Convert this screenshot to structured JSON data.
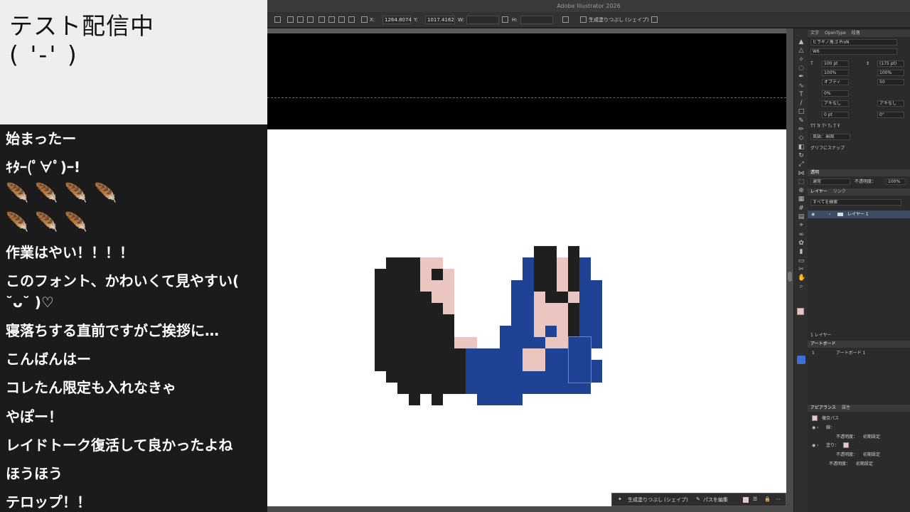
{
  "stream_title": {
    "line1": "テスト配信中",
    "line2": "( '-' )"
  },
  "chat": {
    "messages": [
      "始まったー",
      "ｷﾀｰ(ﾟ∀ﾟ)ｰ!",
      "作業はやい！！！！",
      "このフォント、かわいくて見やすい( ˘ᴗ˘ )♡",
      "寝落ちする直前ですがご挨拶に…",
      "こんばんはー",
      "コレたん限定も入れなきゃ",
      "やぽー！",
      "レイドトーク復活して良かったよね",
      "ほうほう",
      "テロップ！！"
    ],
    "emote_row1": "🪶🪶🪶🪶",
    "emote_row2": "🪶🪶🪶"
  },
  "app": {
    "title": "Adobe Illustrator 2026"
  },
  "control_bar": {
    "x_label": "X:",
    "x_value": "1264.8074",
    "y_label": "Y:",
    "y_value": "1017.4162",
    "w_label": "W:",
    "h_label": "H:",
    "generative_fill": "生成塗りつぶし (シェイプ)"
  },
  "float_bar": {
    "generative_fill": "生成塗りつぶし (シェイプ)",
    "edit_path": "パスを編集"
  },
  "character_panel": {
    "tabs": [
      "文字",
      "OpenType",
      "段落"
    ],
    "font_family": "ヒラギノ角ゴ ProN",
    "font_style": "W6",
    "font_size": "100 pt",
    "leading": "(175 pt)",
    "vscale": "100%",
    "hscale": "100%",
    "kerning": "オプティ",
    "tracking": "50",
    "tsume": "0%",
    "aki_left": "アキなし",
    "aki_right": "アキなし",
    "baseline": "0 pt",
    "rotation": "0°",
    "language": "英語：米国",
    "glyph_snap": "グリフにスナップ"
  },
  "transparency_panel": {
    "tab": "透明",
    "mode": "通常",
    "opacity_label": "不透明度：",
    "opacity": "100%"
  },
  "layers_panel": {
    "tabs": [
      "レイヤー",
      "リンク"
    ],
    "search_placeholder": "すべてを検索",
    "layer_name": "レイヤー 1",
    "count": "1 レイヤー"
  },
  "artboards_panel": {
    "tab": "アートボード",
    "index": "1",
    "name": "アートボード 1"
  },
  "appearance_panel": {
    "tabs": [
      "アピアランス",
      "属性"
    ],
    "object": "複合パス",
    "stroke_label": "線：",
    "fill_label": "塗り：",
    "opacity_label": "不透明度：",
    "opacity_value": "初期設定"
  },
  "colors": {
    "hair": "#1e1f1e",
    "skin": "#ebc6c0",
    "blue": "#1e4394",
    "check": "#1e1f1e",
    "accent": "#3d6fd4"
  },
  "pixel_art": {
    "grid_size": 16,
    "rows": [
      "...............##.#..",
      "..KKKSS.......B##S#B.",
      ".KKKKSKS......B##S#B.",
      ".KKKKSSS.....BB##S#BB",
      ".KKKKKSS.....BBS##SBB",
      ".KKKKKKS.....BBSSS#BB",
      ".KKKKKKK.....BBSSS#BB",
      ".KKKKKKK....BBBSBS#BB",
      ".KKKKKKKSS..BBBBSSBBB",
      ".KKKKKKKKBBBBBSSBBBB.",
      ".KKKKKKKKBBBBBSSBBBBB",
      "..KKKKKKKBBBBBBBBBBBB",
      "...KKKKKKBBBBBBBBBBB.",
      "....K.K...BBBB......."
    ]
  }
}
